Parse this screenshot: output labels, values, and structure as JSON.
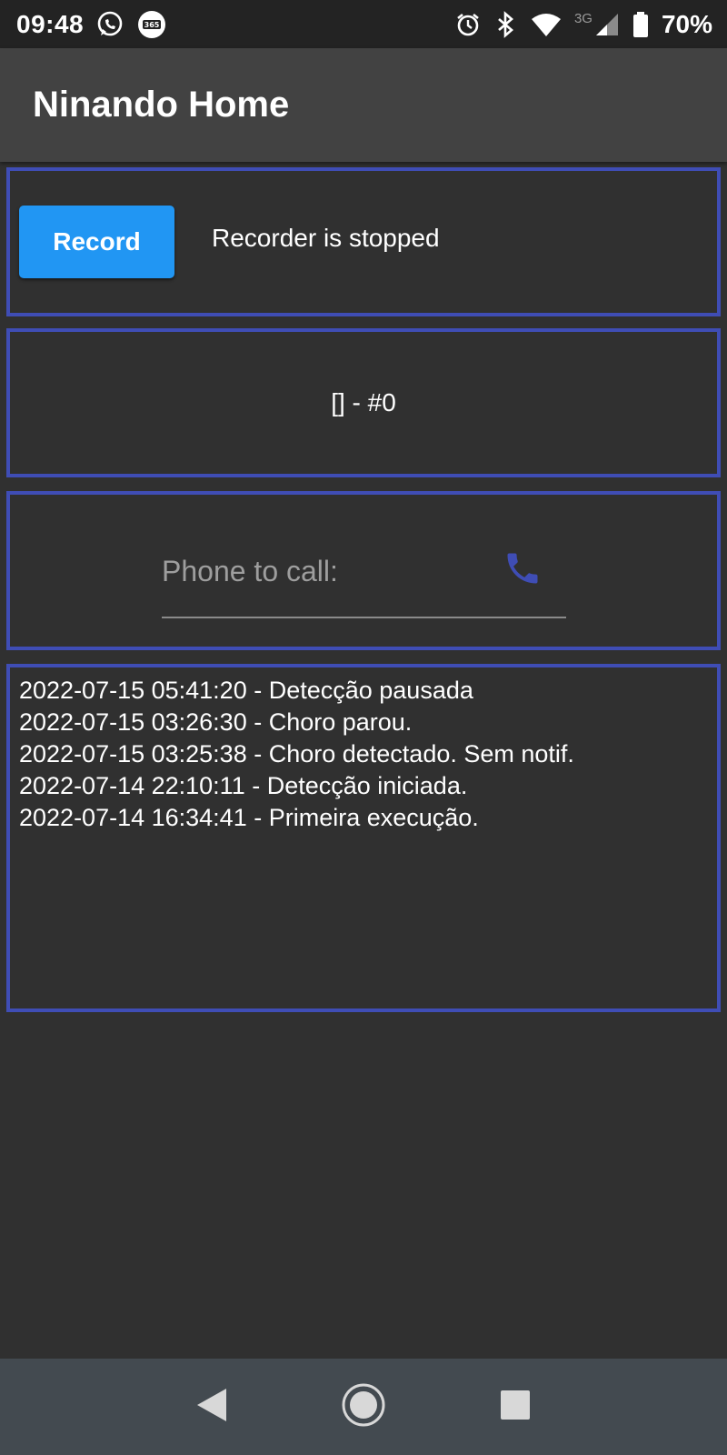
{
  "status_bar": {
    "time": "09:48",
    "battery_percent": "70%",
    "network_type": "3G",
    "icons_left": [
      "whatsapp-icon",
      "app-365-icon"
    ],
    "icons_right": [
      "alarm-icon",
      "bluetooth-icon",
      "wifi-icon",
      "cell-signal-icon",
      "battery-icon"
    ],
    "app_365_label": "365"
  },
  "app_bar": {
    "title": "Ninando Home"
  },
  "recorder": {
    "button_label": "Record",
    "status_text": "Recorder is stopped",
    "button_color": "#2196f3"
  },
  "detection": {
    "text": "[] - #0"
  },
  "phone": {
    "placeholder": "Phone to call:",
    "value": "",
    "call_icon": "phone-icon",
    "call_icon_color": "#3f4db5"
  },
  "log": {
    "entries": [
      "2022-07-15 05:41:20 - Detecção pausada",
      "2022-07-15 03:26:30 - Choro parou.",
      "2022-07-15 03:25:38 - Choro detectado. Sem notif.",
      "2022-07-14 22:10:11 - Detecção iniciada.",
      "2022-07-14 16:34:41 - Primeira execução."
    ]
  },
  "nav_bar": {
    "buttons": [
      "back-icon",
      "home-icon",
      "recents-icon"
    ]
  },
  "theme": {
    "panel_border": "#3f4db5",
    "background": "#303030",
    "app_bar": "#424242"
  }
}
